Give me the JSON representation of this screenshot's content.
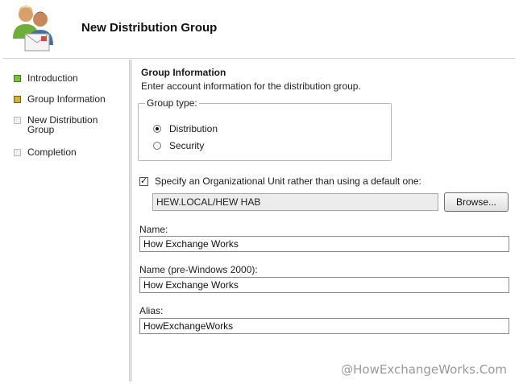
{
  "header": {
    "title": "New Distribution Group",
    "icon": "users-group-icon"
  },
  "steps": [
    {
      "label": "Introduction",
      "state": "done"
    },
    {
      "label": "Group Information",
      "state": "current"
    },
    {
      "label": "New Distribution Group",
      "state": "pending"
    },
    {
      "label": "Completion",
      "state": "pending"
    }
  ],
  "main": {
    "section_title": "Group Information",
    "section_desc": "Enter account information for the distribution group.",
    "group_type": {
      "legend": "Group type:",
      "options": [
        {
          "label": "Distribution",
          "selected": true
        },
        {
          "label": "Security",
          "selected": false
        }
      ]
    },
    "ou_checkbox": {
      "label": "Specify an Organizational Unit rather than using a default one:",
      "checked": true
    },
    "ou_value": "HEW.LOCAL/HEW HAB",
    "browse_label": "Browse...",
    "name": {
      "label": "Name:",
      "value": "How Exchange Works"
    },
    "name_pre2000": {
      "label": "Name (pre-Windows 2000):",
      "value": "How Exchange Works"
    },
    "alias": {
      "label": "Alias:",
      "value": "HowExchangeWorks"
    }
  },
  "watermark": "@HowExchangeWorks.Com"
}
